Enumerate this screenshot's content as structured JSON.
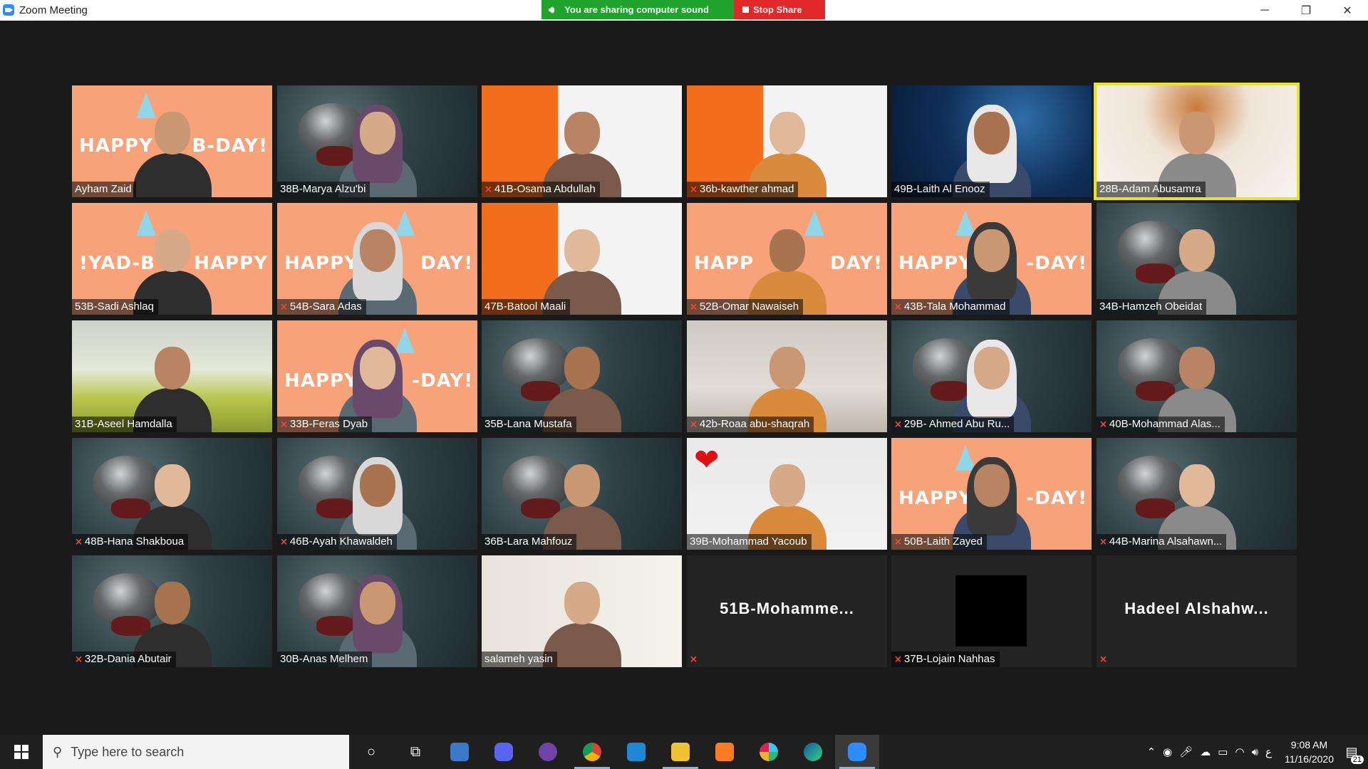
{
  "window": {
    "title": "Zoom Meeting",
    "sharing_label": "You are sharing computer sound",
    "stop_share_label": "Stop Share",
    "controls": {
      "minimize": "─",
      "restore": "❐",
      "close": "✕"
    }
  },
  "participants": [
    {
      "name": "Ayham Zaid",
      "muted": false,
      "bg": "orange",
      "happy_left": "HAPPY",
      "happy_right": "B-DAY!"
    },
    {
      "name": "38B-Marya Alzu'bi",
      "muted": false,
      "bg": "teapot"
    },
    {
      "name": "41B-Osama Abdullah",
      "muted": true,
      "bg": "office"
    },
    {
      "name": "36b-kawther ahmad",
      "muted": true,
      "bg": "office"
    },
    {
      "name": "49B-Laith Al Enooz",
      "muted": false,
      "bg": "space"
    },
    {
      "name": "28B-Adam Abusamra",
      "muted": false,
      "bg": "tea",
      "active_speaker": true
    },
    {
      "name": "53B-Sadi Ashlaq",
      "muted": false,
      "bg": "orange",
      "happy_left": "!YAD-B",
      "happy_right": "HAPPY"
    },
    {
      "name": "54B-Sara Adas",
      "muted": true,
      "bg": "orange",
      "happy_left": "HAPPY",
      "happy_right": "DAY!"
    },
    {
      "name": "47B-Batool Maali",
      "muted": false,
      "bg": "office"
    },
    {
      "name": "52B-Omar Nawaiseh",
      "muted": true,
      "bg": "orange",
      "happy_left": "HAPP",
      "happy_right": "DAY!"
    },
    {
      "name": "43B-Tala Mohammad",
      "muted": true,
      "bg": "orange",
      "happy_left": "HAPPY",
      "happy_right": "-DAY!"
    },
    {
      "name": "34B-Hamzeh Obeidat",
      "muted": false,
      "bg": "teapot"
    },
    {
      "name": "31B-Aseel Hamdalla",
      "muted": false,
      "bg": "green"
    },
    {
      "name": "33B-Feras Dyab",
      "muted": true,
      "bg": "orange",
      "happy_left": "HAPPY",
      "happy_right": "-DAY!"
    },
    {
      "name": "35B-Lana Mustafa",
      "muted": false,
      "bg": "teapot"
    },
    {
      "name": "42b-Roaa abu-shaqrah",
      "muted": true,
      "bg": "room"
    },
    {
      "name": "29B- Ahmed Abu Ru...",
      "muted": true,
      "bg": "teapot"
    },
    {
      "name": "40B-Mohammad Alas...",
      "muted": true,
      "bg": "teapot"
    },
    {
      "name": "48B-Hana Shakboua",
      "muted": true,
      "bg": "teapot"
    },
    {
      "name": "46B-Ayah Khawaldeh",
      "muted": true,
      "bg": "teapot"
    },
    {
      "name": "36B-Lara Mahfouz",
      "muted": false,
      "bg": "teapot"
    },
    {
      "name": "39B-Mohammad Yacoub",
      "muted": false,
      "bg": "heart",
      "heart": "❤"
    },
    {
      "name": "50B-Laith Zayed",
      "muted": true,
      "bg": "orange",
      "happy_left": "HAPPY",
      "happy_right": "-DAY!"
    },
    {
      "name": "44B-Marina Alsahawn...",
      "muted": true,
      "bg": "teapot"
    },
    {
      "name": "32B-Dania Abutair",
      "muted": true,
      "bg": "teapot"
    },
    {
      "name": "30B-Anas Melhem",
      "muted": false,
      "bg": "teapot"
    },
    {
      "name": "salameh yasin",
      "muted": false,
      "bg": "wall"
    },
    {
      "name": "",
      "muted": true,
      "bg": "dark",
      "center_name": "51B-Mohamme..."
    },
    {
      "name": "37B-Lojain Nahhas",
      "muted": true,
      "bg": "dark",
      "black_square": true
    },
    {
      "name": "",
      "muted": true,
      "bg": "dark",
      "center_name": "Hadeel  Alshahw..."
    }
  ],
  "taskbar": {
    "search_placeholder": "Type here to search",
    "time": "9:08 AM",
    "date": "11/16/2020",
    "lang": "ع",
    "notification_count": "21"
  }
}
